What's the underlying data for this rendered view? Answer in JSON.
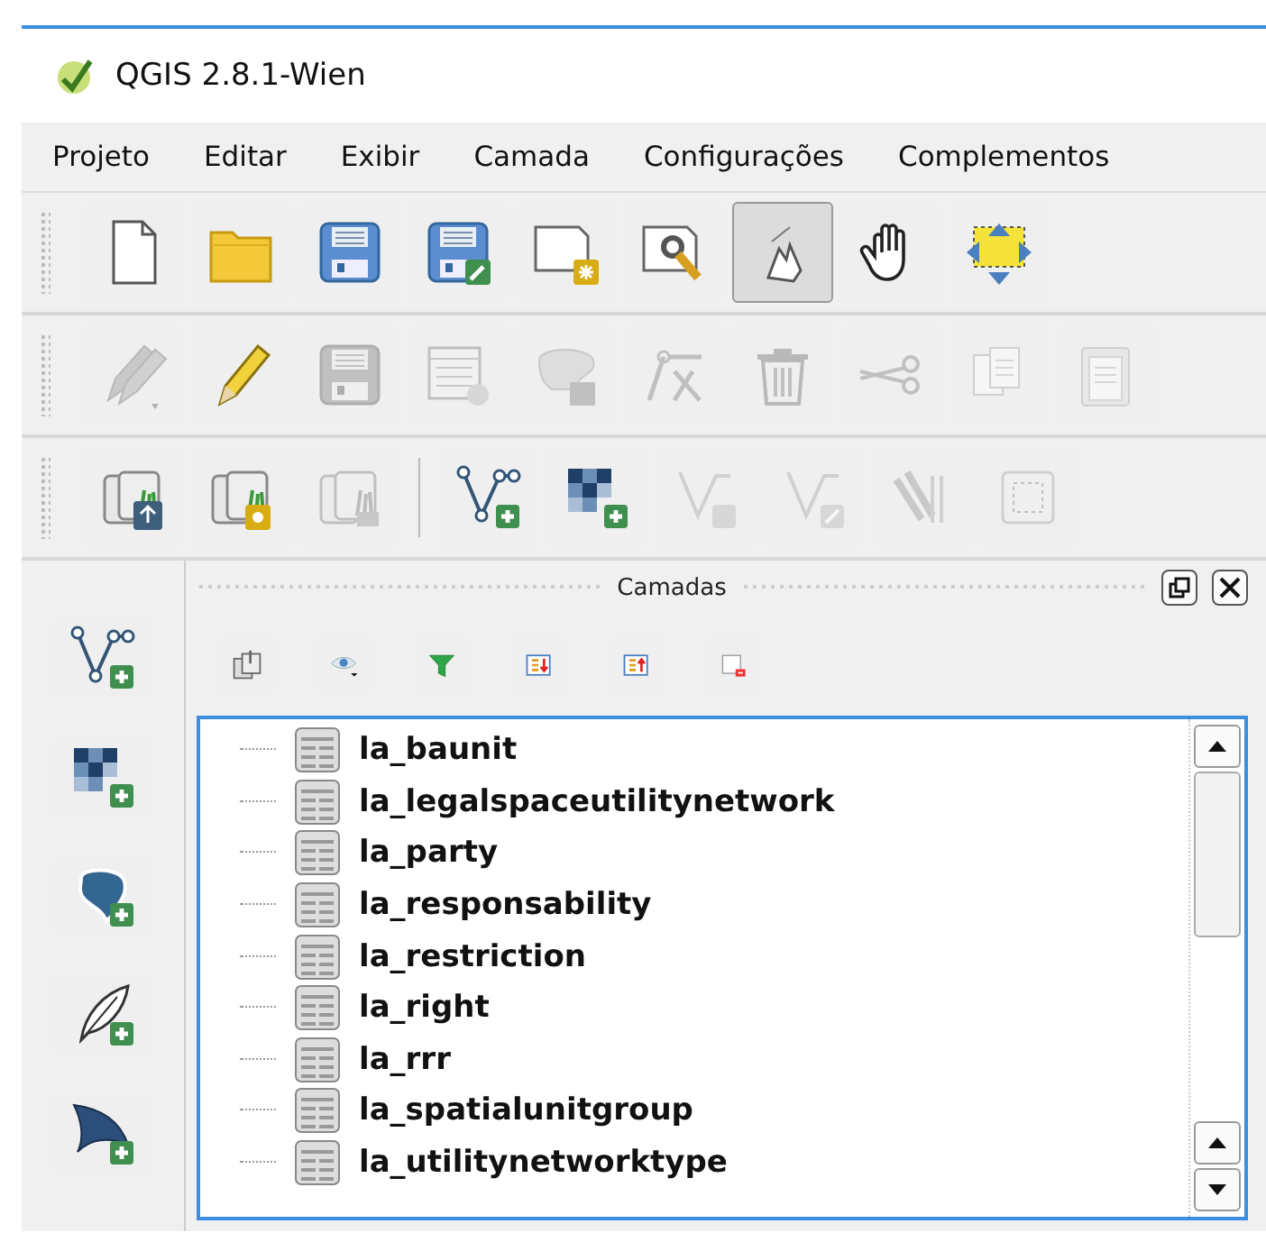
{
  "window": {
    "title": "QGIS 2.8.1-Wien"
  },
  "menu": [
    "Projeto",
    "Editar",
    "Exibir",
    "Camada",
    "Configurações",
    "Complementos"
  ],
  "toolbars": [
    [
      {
        "kind": "new",
        "disabled": false,
        "selected": false
      },
      {
        "kind": "open",
        "disabled": false,
        "selected": false
      },
      {
        "kind": "save",
        "disabled": false,
        "selected": false
      },
      {
        "kind": "saveas",
        "disabled": false,
        "selected": false
      },
      {
        "kind": "composer",
        "disabled": false,
        "selected": false
      },
      {
        "kind": "manager",
        "disabled": false,
        "selected": false
      },
      {
        "kind": "touch",
        "disabled": false,
        "selected": true
      },
      {
        "kind": "pan",
        "disabled": false,
        "selected": false
      },
      {
        "kind": "pansel",
        "disabled": false,
        "selected": false
      }
    ],
    [
      {
        "kind": "edits",
        "disabled": true,
        "selected": false
      },
      {
        "kind": "pencil",
        "disabled": false,
        "selected": false
      },
      {
        "kind": "save",
        "disabled": true,
        "selected": false
      },
      {
        "kind": "table",
        "disabled": true,
        "selected": false
      },
      {
        "kind": "shape",
        "disabled": true,
        "selected": false
      },
      {
        "kind": "node",
        "disabled": true,
        "selected": false
      },
      {
        "kind": "trash",
        "disabled": true,
        "selected": false
      },
      {
        "kind": "scissors",
        "disabled": true,
        "selected": false
      },
      {
        "kind": "copy",
        "disabled": true,
        "selected": false
      },
      {
        "kind": "paste",
        "disabled": true,
        "selected": false
      }
    ],
    [
      {
        "kind": "layerup",
        "disabled": false,
        "selected": false
      },
      {
        "kind": "layerstar",
        "disabled": false,
        "selected": false
      },
      {
        "kind": "layerplain",
        "disabled": true,
        "selected": false
      },
      {
        "kind": "vectoradd",
        "disabled": false,
        "selected": false
      },
      {
        "kind": "rasteradd",
        "disabled": false,
        "selected": false
      },
      {
        "kind": "vectorstar",
        "disabled": true,
        "selected": false
      },
      {
        "kind": "vectoredit",
        "disabled": true,
        "selected": false
      },
      {
        "kind": "tools",
        "disabled": true,
        "selected": false
      },
      {
        "kind": "frame",
        "disabled": true,
        "selected": false
      }
    ]
  ],
  "dock": [
    {
      "kind": "vectoradd"
    },
    {
      "kind": "rasteradd"
    },
    {
      "kind": "postgis"
    },
    {
      "kind": "feather"
    },
    {
      "kind": "wing"
    }
  ],
  "layers_panel": {
    "title": "Camadas",
    "toolbar": [
      {
        "kind": "addgroup"
      },
      {
        "kind": "eye"
      },
      {
        "kind": "filter"
      },
      {
        "kind": "expand"
      },
      {
        "kind": "collapse"
      },
      {
        "kind": "remove"
      }
    ],
    "items": [
      {
        "name": "la_baunit"
      },
      {
        "name": "la_legalspaceutilitynetwork"
      },
      {
        "name": "la_party"
      },
      {
        "name": "la_responsability"
      },
      {
        "name": "la_restriction"
      },
      {
        "name": "la_right"
      },
      {
        "name": "la_rrr"
      },
      {
        "name": "la_spatialunitgroup"
      },
      {
        "name": "la_utilitynetworktype"
      }
    ]
  }
}
